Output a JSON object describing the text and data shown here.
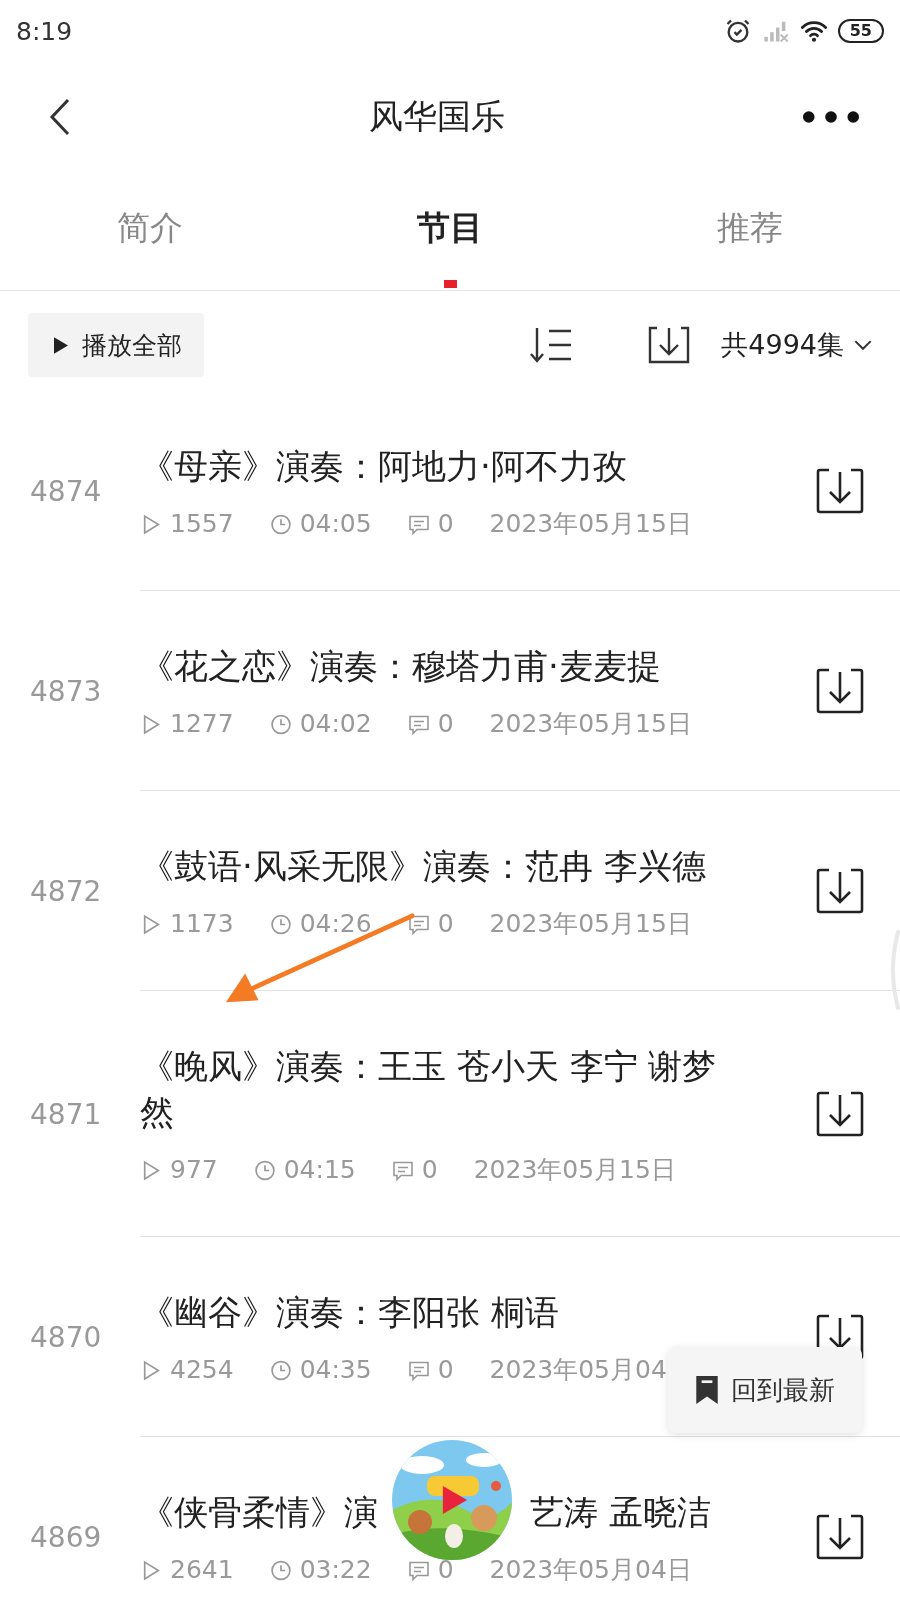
{
  "status_bar": {
    "time": "8:19",
    "battery": "55"
  },
  "header": {
    "title": "风华国乐"
  },
  "tabs": [
    {
      "label": "简介",
      "selected": false
    },
    {
      "label": "节目",
      "selected": true
    },
    {
      "label": "推荐",
      "selected": false
    }
  ],
  "toolbar": {
    "play_all": "播放全部",
    "count": "共4994集"
  },
  "episodes": [
    {
      "number": "4874",
      "title_parts": [
        "《母亲》演奏：阿地力·阿不力孜"
      ],
      "plays": "1557",
      "duration": "04:05",
      "comments": "0",
      "date": "2023年05月15日"
    },
    {
      "number": "4873",
      "title_parts": [
        "《花之恋》演奏：穆塔力甫·麦麦提"
      ],
      "plays": "1277",
      "duration": "04:02",
      "comments": "0",
      "date": "2023年05月15日"
    },
    {
      "number": "4872",
      "title_parts": [
        "《鼓语·风采无限》演奏：范冉 李兴德"
      ],
      "plays": "1173",
      "duration": "04:26",
      "comments": "0",
      "date": "2023年05月15日"
    },
    {
      "number": "4871",
      "title_parts": [
        "《晚风》演奏：王玉 苍小天 李宁 谢梦然"
      ],
      "plays": "977",
      "duration": "04:15",
      "comments": "0",
      "date": "2023年05月15日"
    },
    {
      "number": "4870",
      "title_parts": [
        "《幽谷》演奏：李阳张 桐语"
      ],
      "plays": "4254",
      "duration": "04:35",
      "comments": "0",
      "date": "2023年05月04"
    },
    {
      "number": "4869",
      "title_parts": [
        "《侠骨柔情》演",
        "艺涛 孟晓洁"
      ],
      "plays": "2641",
      "duration": "03:22",
      "comments": "0",
      "date": "2023年05月04日"
    }
  ],
  "back_to_latest": "回到最新",
  "annotations": [
    {
      "kind": "arrow"
    }
  ]
}
